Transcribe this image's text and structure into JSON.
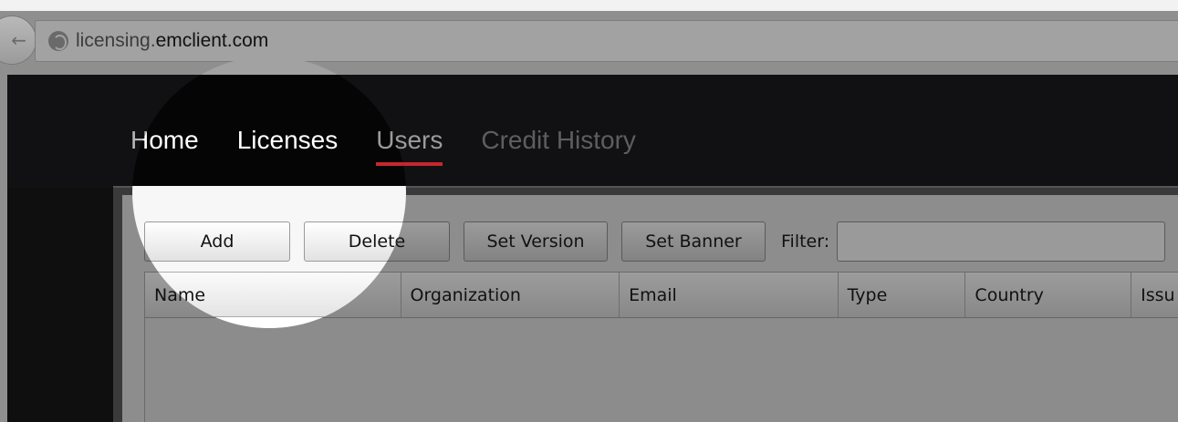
{
  "browser": {
    "url_prefix": "licensing.",
    "url_host": "emclient.com",
    "back_icon": "back-arrow-icon",
    "site_icon": "globe-icon"
  },
  "nav": {
    "items": [
      {
        "label": "Home"
      },
      {
        "label": "Licenses"
      },
      {
        "label": "Users",
        "active": true
      },
      {
        "label": "Credit History"
      }
    ],
    "active_color": "#c8262e"
  },
  "toolbar": {
    "add_label": "Add",
    "delete_label": "Delete",
    "set_version_label": "Set Version",
    "set_banner_label": "Set Banner",
    "filter_label": "Filter:",
    "filter_value": ""
  },
  "grid": {
    "columns": [
      "Name",
      "Organization",
      "Email",
      "Type",
      "Country",
      "Issu"
    ]
  }
}
